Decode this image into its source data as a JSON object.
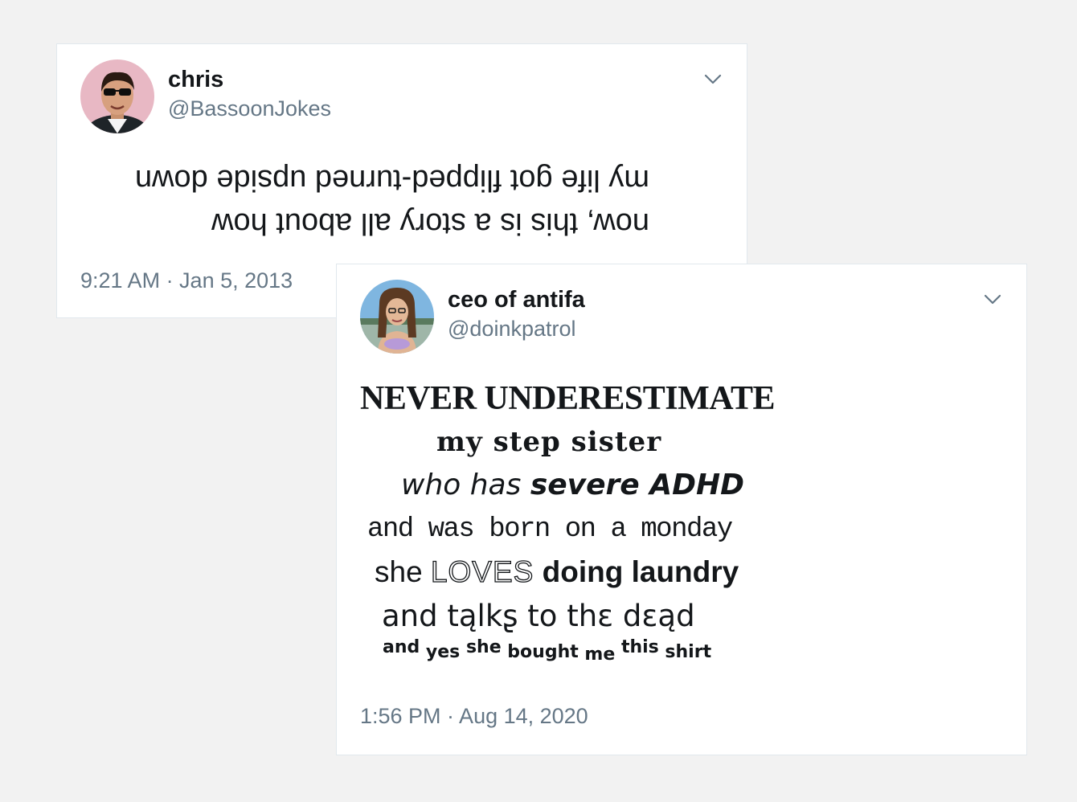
{
  "tweets": [
    {
      "name": "chris",
      "handle": "@BassoonJokes",
      "body_lines": [
        "my life got flipped-turned upside down",
        "now, this is a story all about how"
      ],
      "timestamp": "9:21 AM · Jan 5, 2013"
    },
    {
      "name": "ceo of antifa",
      "handle": "@doinkpatrol",
      "body": {
        "line1": "NEVER UNDERESTIMATE",
        "line2": "my step sister",
        "line3_a": "who has ",
        "line3_b": "severe ADHD",
        "line4": "and was born on a monday",
        "line5_a": "she ",
        "line5_b": "LOVES",
        "line5_c": " doing laundry",
        "line6": "and tąlkʂ to thɛ dɛąd",
        "line7": [
          "and",
          " yes ",
          "she",
          " bought",
          " me ",
          "this",
          " shirt"
        ]
      },
      "timestamp": "1:56 PM · Aug 14, 2020"
    }
  ],
  "icons": {
    "chevron": "chevron-down-icon",
    "avatar": "avatar"
  },
  "colors": {
    "background": "#f2f2f2",
    "card": "#ffffff",
    "text": "#14171a",
    "secondary": "#657786"
  }
}
